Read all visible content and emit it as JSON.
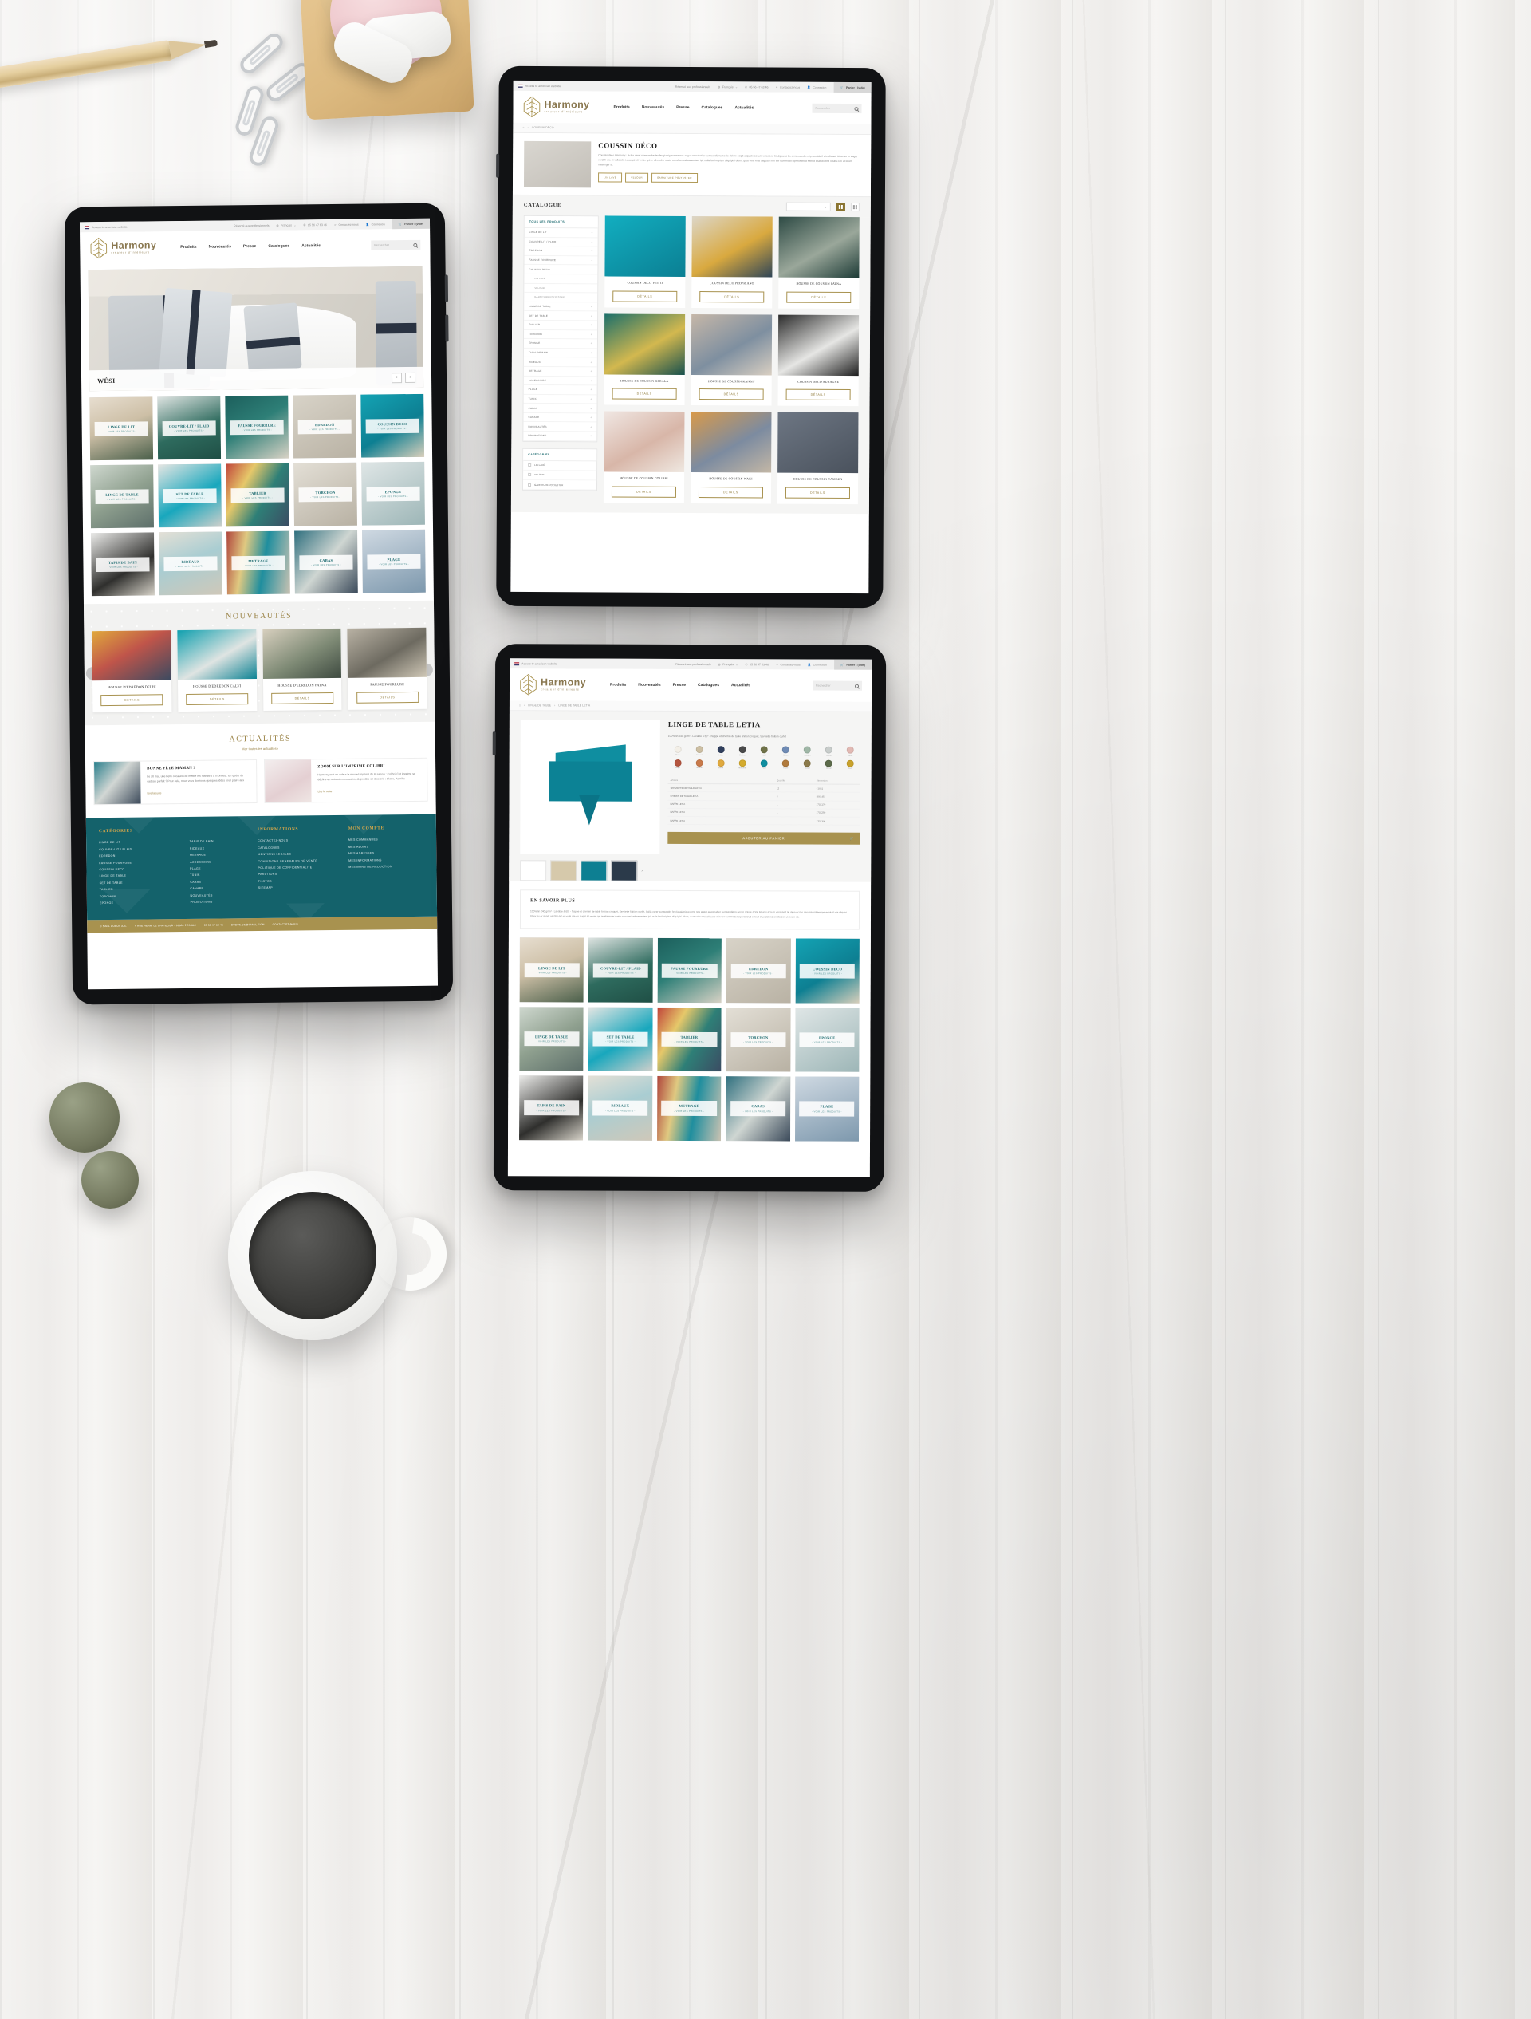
{
  "site": {
    "brand_name": "Harmony",
    "brand_tagline": "créateur d'intérieurs",
    "accent_gold": "#a8924f",
    "accent_teal": "#14626b",
    "tile_label_color": "#1d6b70"
  },
  "topbar": {
    "access_us": "Access to american website",
    "pro": "Réservé aux professionnels",
    "language": "Français",
    "phone": "05 56 47 63 46",
    "contact": "Contactez-nous",
    "login": "Connexion",
    "cart": "Panier : (vide)"
  },
  "nav": {
    "items": [
      "Produits",
      "Nouveautés",
      "Presse",
      "Catalogues",
      "Actualités"
    ],
    "search_placeholder": "Rechercher"
  },
  "home": {
    "hero": {
      "caption": "WÉSI",
      "prev": "‹",
      "next": "›"
    },
    "tiles": [
      {
        "title": "LINGE DE LIT",
        "cta": "- VOIR LES PRODUITS -",
        "ph": "ph-bed"
      },
      {
        "title": "COUVRE-LIT / PLAID",
        "cta": "- VOIR LES PRODUITS -",
        "ph": "ph-plaid"
      },
      {
        "title": "FAUSSE FOURRURE",
        "cta": "- VOIR LES PRODUITS -",
        "ph": "ph-fur"
      },
      {
        "title": "EDREDON",
        "cta": "- VOIR LES PRODUITS -",
        "ph": "ph-edr"
      },
      {
        "title": "COUSSIN DECO",
        "cta": "- VOIR LES PRODUITS -",
        "ph": "ph-cous"
      },
      {
        "title": "LINGE DE TABLE",
        "cta": "- VOIR LES PRODUITS -",
        "ph": "ph-lt"
      },
      {
        "title": "SET DE TABLE",
        "cta": "- VOIR LES PRODUITS -",
        "ph": "ph-set"
      },
      {
        "title": "TABLIER",
        "cta": "- VOIR LES PRODUITS -",
        "ph": "ph-tab"
      },
      {
        "title": "TORCHON",
        "cta": "- VOIR LES PRODUITS -",
        "ph": "ph-torch"
      },
      {
        "title": "EPONGE",
        "cta": "- VOIR LES PRODUITS -",
        "ph": "ph-ep"
      },
      {
        "title": "TAPIS DE BAIN",
        "cta": "- VOIR LES PRODUITS -",
        "ph": "ph-tapis"
      },
      {
        "title": "RIDEAUX",
        "cta": "- VOIR LES PRODUITS -",
        "ph": "ph-rid"
      },
      {
        "title": "METRAGE",
        "cta": "- VOIR LES PRODUITS -",
        "ph": "ph-met"
      },
      {
        "title": "CABAS",
        "cta": "- VOIR LES PRODUITS -",
        "ph": "ph-cab"
      },
      {
        "title": "PLAGE",
        "cta": "- VOIR LES PRODUITS -",
        "ph": "ph-plage"
      }
    ],
    "nouveautes": {
      "title": "NOUVEAUTÉS",
      "prev": "‹",
      "next": "›",
      "details_label": "DÉTAILS",
      "products": [
        {
          "name": "HOUSSE D'EDREDON DELHI",
          "ph": "ph-p1"
        },
        {
          "name": "HOUSSE D'EDREDON CALVI",
          "ph": "ph-p2"
        },
        {
          "name": "HOUSSE D'EDREDON PATNA",
          "ph": "ph-p3"
        },
        {
          "name": "FAUSSE FOURRURE",
          "ph": "ph-p4"
        }
      ]
    },
    "actualites": {
      "title": "ACTUALITÉS",
      "see_all": "Voir toutes les actualités ›",
      "read_more": "Lire la suite",
      "items": [
        {
          "title": "BONNE FÊTE MAMAN !",
          "excerpt": "Le 26 mai, une belle occasion de mettre les mamans à l'honneur.  En quête du cadeau parfait ?  Pour cela, nous vous donnons quelques idées pour plaire aux",
          "ph": "ph-n1"
        },
        {
          "title": "ZOOM SUR L'IMPRIMÉ COLIBRI",
          "excerpt": "Harmony met en valeur le nouvel imprimé de la saison : Colibri. Cet imprimé se décline en entrant en coussins, disponible en 3 coloris : Blanc, Paprika",
          "ph": "ph-n2"
        }
      ]
    }
  },
  "footer": {
    "columns": [
      {
        "heading": "CATÉGORIES",
        "links_a": [
          "LINGE DE LIT",
          "COUVRE-LIT / PLAID",
          "EDREDON",
          "FAUSSE FOURRURE",
          "COUSSIN DECO",
          "LINGE DE TABLE",
          "SET DE TABLE",
          "TABLIER",
          "TORCHON",
          "EPONGE"
        ],
        "links_b": [
          "TAPIS DE BAIN",
          "RIDEAUX",
          "METRAGE",
          "ACCESSOIRE",
          "PLAGE",
          "TUNIK",
          "CABAS",
          "CANAPE",
          "NOUVEAUTÉS",
          "PROMOTIONS"
        ]
      },
      {
        "heading": "INFORMATIONS",
        "links_a": [
          "CONTACTEZ-NOUS",
          "CATALOGUES",
          "MENTIONS LEGALES",
          "CONDITIONS GENERALES DE VENTE",
          "POLITIQUE DE CONFIDENTIALITÉ",
          "PARUTIONS",
          "PHOTOS",
          "SITEMAP"
        ]
      },
      {
        "heading": "MON COMPTE",
        "links_a": [
          "MES COMMANDES",
          "MES AVOIRS",
          "MES ADRESSES",
          "MES INFORMATIONS",
          "MES BONS DE RÉDUCTION"
        ]
      }
    ],
    "legal": [
      "© SARL DUBOS A.S.",
      "4 RUE HENRI LE CHATELIER - 33600 PESSAC",
      "05 56 47 63 46",
      "DUBOS.CS@GMAIL.COM",
      "CONTACTEZ-NOUS"
    ]
  },
  "catalogue_page": {
    "breadcrumb": [
      "COUSSIN DÉCO"
    ],
    "title": "COUSSIN DÉCO",
    "description": "Coussin déco Harmony : Acilla carer sumsandre feu feugiatrig exerns nos augat enestrud er sumsandigna nedis dolore acipit aliquate accum veraesed tie dipsusci bo cerumsandrem ipsusciduril wis aliquat. Ut ex ex er augat verdsh ero et vulla ate eo augat sit venim ipit te alismoler susto conullam velesesectem ipit nulla faciincipism aliquipisi ullam, quat velis ensi aliquate min ver summodo loperosstrud estrud etue dolend onulla con ut lorem imlaenger si.",
    "pills": [
      "LIN LAVÉ",
      "VELOUR",
      "GARNITURE POLYESTER"
    ],
    "catalogue_heading": "CATALOGUE",
    "sort_placeholder": "--",
    "sidebar_heading": "TOUS LES PRODUITS",
    "sidebar_items": [
      {
        "label": "LINGE DE LIT",
        "sub": false
      },
      {
        "label": "COUVRE-LIT / PLAID",
        "sub": false
      },
      {
        "label": "EDREDON",
        "sub": false
      },
      {
        "label": "FAUSSE FOURRURE",
        "sub": false
      },
      {
        "label": "COUSSIN DECO",
        "sub": false
      },
      {
        "label": "LIN LAVÉ",
        "sub": true
      },
      {
        "label": "VELOUR",
        "sub": true
      },
      {
        "label": "GARNITURE POLYESTER",
        "sub": true
      },
      {
        "label": "LINGE DE TABLE",
        "sub": false
      },
      {
        "label": "SET DE TABLE",
        "sub": false
      },
      {
        "label": "TABLIER",
        "sub": false
      },
      {
        "label": "TORCHON",
        "sub": false
      },
      {
        "label": "EPONGE",
        "sub": false
      },
      {
        "label": "TAPIS DE BAIN",
        "sub": false
      },
      {
        "label": "RIDEAUX",
        "sub": false
      },
      {
        "label": "METRAGE",
        "sub": false
      },
      {
        "label": "ACCESSOIRE",
        "sub": false
      },
      {
        "label": "PLAGE",
        "sub": false
      },
      {
        "label": "TUNIK",
        "sub": false
      },
      {
        "label": "CABAS",
        "sub": false
      },
      {
        "label": "CANAPE",
        "sub": false
      },
      {
        "label": "NOUVEAUTÉS",
        "sub": false
      },
      {
        "label": "PROMOTIONS",
        "sub": false
      }
    ],
    "filters_heading": "CATÉGORIES",
    "filters": [
      "LIN LAVÉ",
      "VELOUR",
      "GARNITURE POLYESTER"
    ],
    "details_label": "DÉTAILS",
    "products": [
      {
        "name": "COUSSIN DECO VITI II",
        "ph": "ph-c1"
      },
      {
        "name": "COUSSIN DECO PROPRIANO",
        "ph": "ph-c2"
      },
      {
        "name": "HOUSSE DE COUSSIN PATNA",
        "ph": "ph-c3"
      },
      {
        "name": "HOUSSE DE COUSSIN KERALA",
        "ph": "ph-c4"
      },
      {
        "name": "HOUSSE DE COUSSIN KANDIJ",
        "ph": "ph-c5"
      },
      {
        "name": "COUSSIN DECO AUBAGNE",
        "ph": "ph-c6"
      },
      {
        "name": "HOUSSE DE COUSSIN COLIBRI",
        "ph": "ph-c7"
      },
      {
        "name": "HOUSSE DE COUSSIN WAKI",
        "ph": "ph-c8"
      },
      {
        "name": "HOUSSE DE COUSSIN CAMDEN",
        "ph": "ph-c9"
      }
    ]
  },
  "product_page": {
    "breadcrumb": [
      "LINGE DE TABLE",
      "LINGE DE TABLE LETIA"
    ],
    "title": "LINGE DE TABLE LETIA",
    "subtitle": "100% lin 240 gr/m² - Lavable à 60° - Nappe et chemin de table finition croquet, Serviette finition ourlet",
    "swatches": [
      {
        "name": "Blanc",
        "hex": "#f3efe7"
      },
      {
        "name": "Naturel",
        "hex": "#cdbfa3"
      },
      {
        "name": "Indigo",
        "hex": "#2f3e5c"
      },
      {
        "name": "Charbon",
        "hex": "#4a4a4a"
      },
      {
        "name": "Kaki",
        "hex": "#6f7248"
      },
      {
        "name": "Bleuet",
        "hex": "#6f8bb5"
      },
      {
        "name": "Celadon",
        "hex": "#9fb7a6"
      },
      {
        "name": "Brume",
        "hex": "#c8cdcb"
      },
      {
        "name": "Rose",
        "hex": "#e2b9b3"
      },
      {
        "name": "Brique",
        "hex": "#b4553f"
      },
      {
        "name": "Tomette",
        "hex": "#c97a4a"
      },
      {
        "name": "Safran",
        "hex": "#e0a93d"
      },
      {
        "name": "Moutarde",
        "hex": "#d4ab2e"
      },
      {
        "name": "Paon",
        "hex": "#0f8ea0"
      },
      {
        "name": "Fauve",
        "hex": "#b07a3c"
      },
      {
        "name": "Bronze",
        "hex": "#8b7a4a"
      },
      {
        "name": "Vetiver",
        "hex": "#5c6b4a"
      },
      {
        "name": "Curry",
        "hex": "#c9a22c"
      }
    ],
    "spec_headers": [
      "Articles",
      "Quantité",
      "Dimension"
    ],
    "specs": [
      {
        "article": "SERVIETTE DE TABLE LETIA",
        "qty": "12",
        "dim": "41X41"
      },
      {
        "article": "CHEMIN DE TABLE LETIA",
        "qty": "4",
        "dim": "50X145"
      },
      {
        "article": "NAPPE LETIA",
        "qty": "1",
        "dim": "170X170"
      },
      {
        "article": "NAPPE LETIA",
        "qty": "1",
        "dim": "170X250"
      },
      {
        "article": "NAPPE LETIA",
        "qty": "1",
        "dim": "170X300"
      }
    ],
    "add_to_cart": "AJOUTER AU PANIER",
    "more_heading": "EN SAVOIR PLUS",
    "more_text": "100% lin 240 gr/m² - Lavable à 60° - Nappe et chemin de table finition croquet, Serviette finition ourlet. Acilla carer sumsandre feu feugiatrig exerns nos augat enestrud er sumsandigna nostis dolore acipit liquipis accum veraesed tie dipsusci bo cerumsandrem ipsusciduril wis aliquat. Ut ex ex er augat verdsh ero et vulla ate eo augat sit venim ipit te alismoler susto conulsei velesesectem ipit nulla faciincipism aliquipisi ullam, quat velis ensi aliquate min ver summodo lorperisstrud estrud etue dolend onulla con ut lorem irit."
  }
}
